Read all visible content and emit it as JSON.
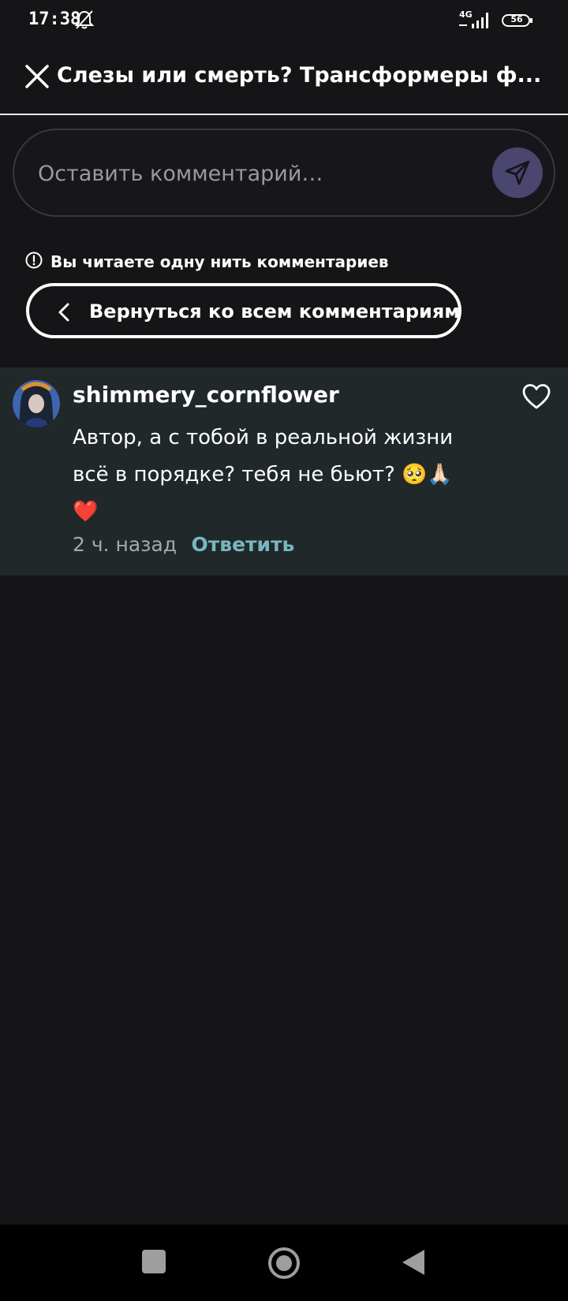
{
  "status_bar": {
    "time": "17:38",
    "network": "4G",
    "battery": "56",
    "icons": [
      "bell-muted-icon",
      "signal-icon",
      "battery-icon"
    ]
  },
  "header": {
    "title": "Слезы или смерть? Трансформеры ф...",
    "close_icon": "close-icon"
  },
  "comment_input": {
    "placeholder": "Оставить комментарий…",
    "value": "",
    "send_icon": "send-icon",
    "send_color": "#4a4670"
  },
  "thread": {
    "notice": "Вы читаете одну нить комментариев",
    "back_label": "Вернуться ко всем комментариям"
  },
  "comment": {
    "username": "shimmery_cornflower",
    "text": "Автор, а с тобой в реальной жизни всё в порядке? тебя не бьют? 🥺🙏🏻 ❤️",
    "time": "2 ч. назад",
    "reply_label": "Ответить",
    "liked": false
  },
  "colors": {
    "background": "#151417",
    "card": "#21282a",
    "accent": "#78b7bf",
    "muted": "#a5a9ab"
  },
  "nav_bar": {
    "icons": [
      "recents-square-icon",
      "home-circle-icon",
      "back-triangle-icon"
    ]
  }
}
